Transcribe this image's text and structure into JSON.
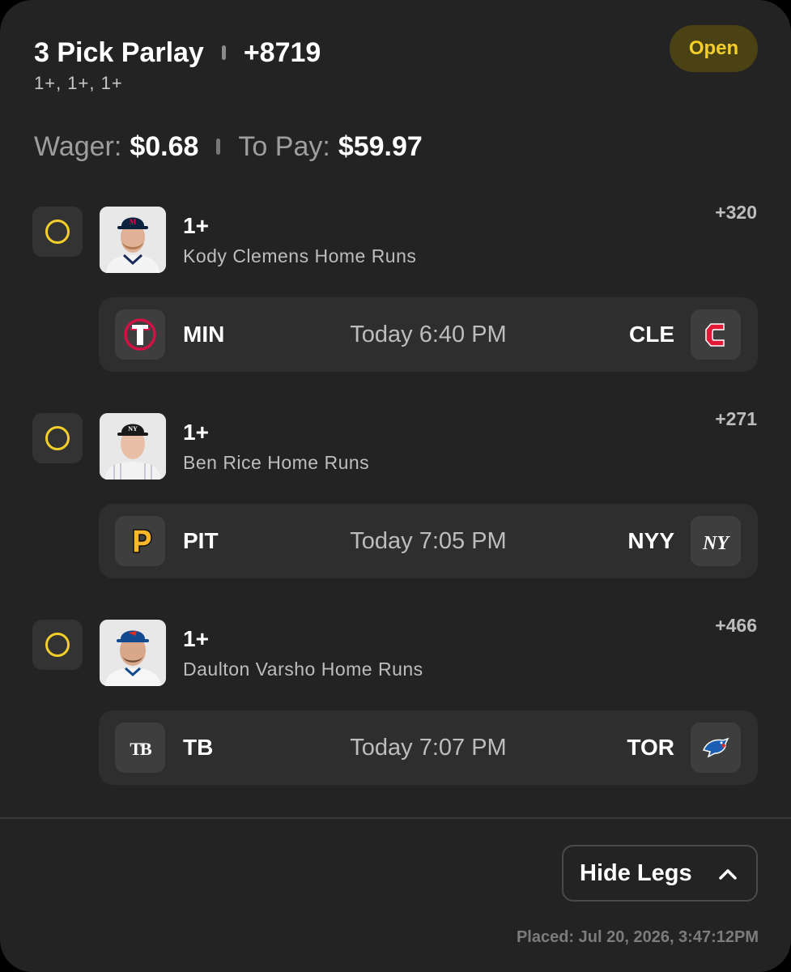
{
  "header": {
    "title": "3 Pick Parlay",
    "total_odds": "+8719",
    "subtitle": "1+, 1+, 1+",
    "status": "Open",
    "wager_label": "Wager:",
    "wager_value": "$0.68",
    "topay_label": "To Pay:",
    "topay_value": "$59.97"
  },
  "legs": [
    {
      "line": "1+",
      "market": "Kody Clemens Home Runs",
      "odds": "+320",
      "away": "MIN",
      "home": "CLE",
      "time": "Today 6:40 PM"
    },
    {
      "line": "1+",
      "market": "Ben Rice Home Runs",
      "odds": "+271",
      "away": "PIT",
      "home": "NYY",
      "time": "Today 7:05 PM"
    },
    {
      "line": "1+",
      "market": "Daulton Varsho Home Runs",
      "odds": "+466",
      "away": "TB",
      "home": "TOR",
      "time": "Today 7:07 PM"
    }
  ],
  "footer": {
    "hide_legs_label": "Hide Legs",
    "placed": "Placed: Jul 20, 2026, 3:47:12PM"
  },
  "colors": {
    "card_bg": "#232323",
    "accent_yellow": "#f4cf2a",
    "badge_bg": "#4a4214",
    "row_bg": "#2e2e2e"
  }
}
